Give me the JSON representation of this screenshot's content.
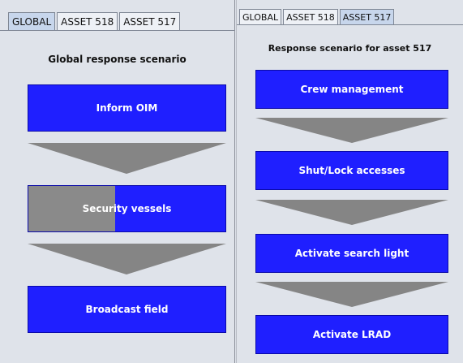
{
  "left": {
    "tabs": [
      "GLOBAL",
      "ASSET 518",
      "ASSET 517"
    ],
    "active_tab": 0,
    "title": "Global response scenario",
    "buttons": [
      {
        "label": "Inform OIM"
      },
      {
        "label": "Security vessels",
        "progress": 0.44
      },
      {
        "label": "Broadcast field"
      }
    ]
  },
  "right": {
    "tabs": [
      "GLOBAL",
      "ASSET 518",
      "ASSET 517"
    ],
    "active_tab": 2,
    "title": "Response scenario for asset 517",
    "buttons": [
      {
        "label": "Crew management"
      },
      {
        "label": "Shut/Lock accesses"
      },
      {
        "label": "Activate search light"
      },
      {
        "label": "Activate LRAD"
      }
    ]
  },
  "colors": {
    "button_blue": "#1f1fff",
    "progress_gray": "#8a8a8a",
    "arrow_gray": "#858585",
    "background": "#dfe3ea"
  }
}
